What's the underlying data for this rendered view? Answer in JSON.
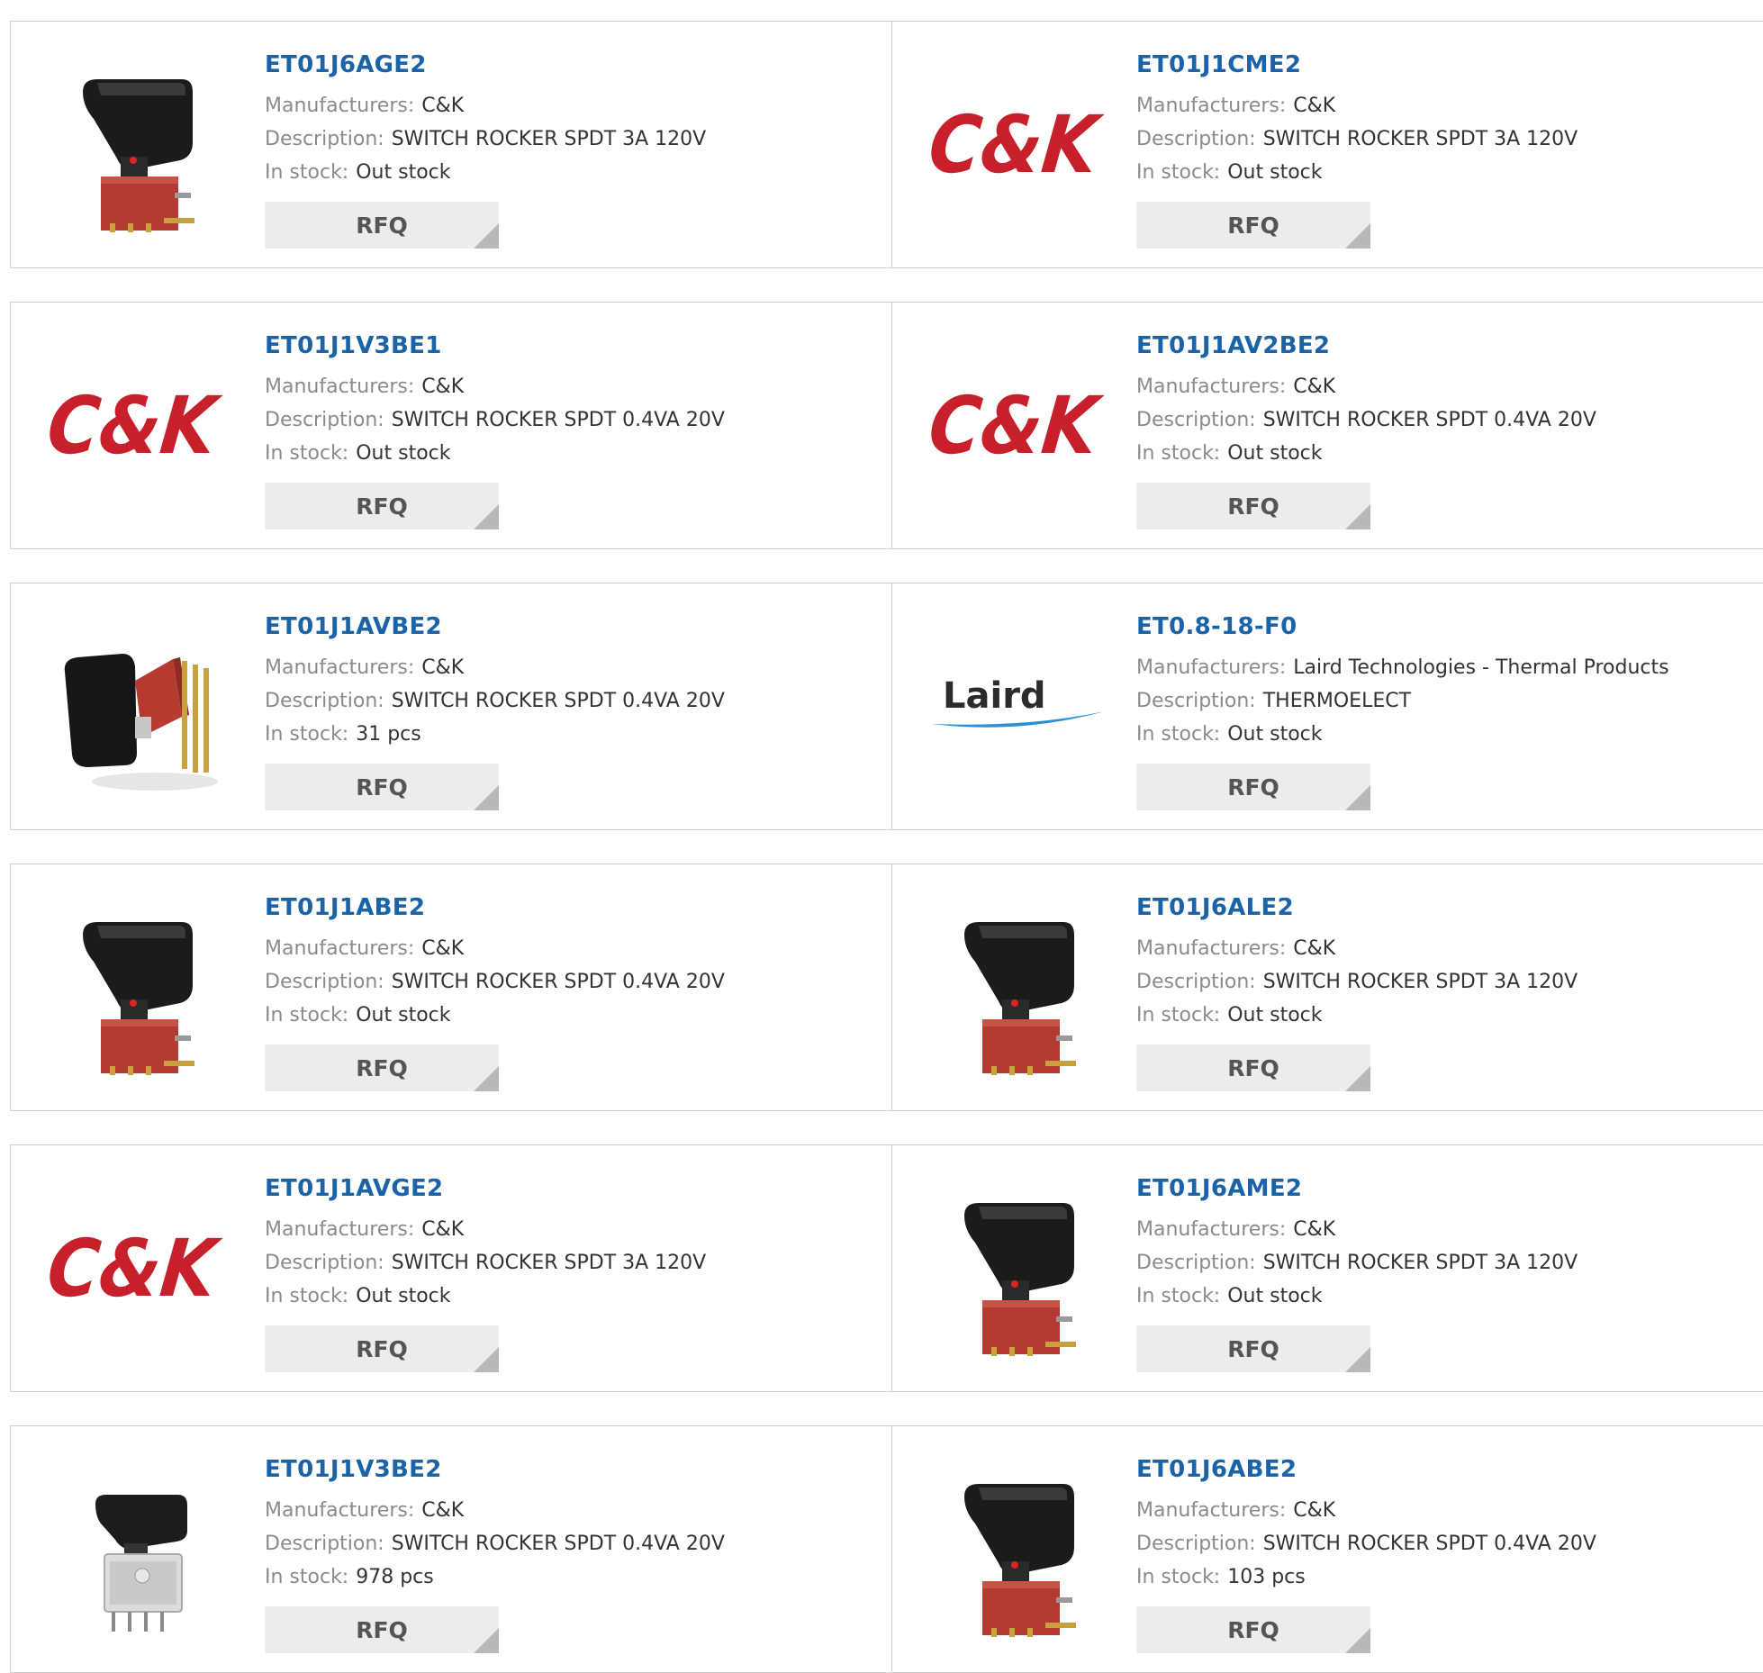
{
  "labels": {
    "manufacturers": "Manufacturers:",
    "description": "Description:",
    "in_stock": "In stock:",
    "rfq": "RFQ"
  },
  "products": [
    {
      "part": "ET01J6AGE2",
      "manufacturer": "C&K",
      "description": "SWITCH ROCKER SPDT 3A 120V",
      "stock": "Out stock",
      "image": "rocker-switch-red-base"
    },
    {
      "part": "ET01J1CME2",
      "manufacturer": "C&K",
      "description": "SWITCH ROCKER SPDT 3A 120V",
      "stock": "Out stock",
      "image": "ck-logo",
      "logo_text": "C&K"
    },
    {
      "part": "ET01J1V3BE1",
      "manufacturer": "C&K",
      "description": "SWITCH ROCKER SPDT 0.4VA 20V",
      "stock": "Out stock",
      "image": "ck-logo",
      "logo_text": "C&K"
    },
    {
      "part": "ET01J1AV2BE2",
      "manufacturer": "C&K",
      "description": "SWITCH ROCKER SPDT 0.4VA 20V",
      "stock": "Out stock",
      "image": "ck-logo",
      "logo_text": "C&K"
    },
    {
      "part": "ET01J1AVBE2",
      "manufacturer": "C&K",
      "description": "SWITCH ROCKER SPDT 0.4VA 20V",
      "stock": "31 pcs",
      "image": "rocker-switch-right-angle"
    },
    {
      "part": "ET0.8-18-F0",
      "manufacturer": "Laird Technologies - Thermal Products",
      "description": "THERMOELECT",
      "stock": "Out stock",
      "image": "laird-logo",
      "logo_text": "Laird"
    },
    {
      "part": "ET01J1ABE2",
      "manufacturer": "C&K",
      "description": "SWITCH ROCKER SPDT 0.4VA 20V",
      "stock": "Out stock",
      "image": "rocker-switch-red-base"
    },
    {
      "part": "ET01J6ALE2",
      "manufacturer": "C&K",
      "description": "SWITCH ROCKER SPDT 3A 120V",
      "stock": "Out stock",
      "image": "rocker-switch-red-base"
    },
    {
      "part": "ET01J1AVGE2",
      "manufacturer": "C&K",
      "description": "SWITCH ROCKER SPDT 3A 120V",
      "stock": "Out stock",
      "image": "ck-logo",
      "logo_text": "C&K"
    },
    {
      "part": "ET01J6AME2",
      "manufacturer": "C&K",
      "description": "SWITCH ROCKER SPDT 3A 120V",
      "stock": "Out stock",
      "image": "rocker-switch-red-base"
    },
    {
      "part": "ET01J1V3BE2",
      "manufacturer": "C&K",
      "description": "SWITCH ROCKER SPDT 0.4VA 20V",
      "stock": "978 pcs",
      "image": "rocker-switch-clear-base"
    },
    {
      "part": "ET01J6ABE2",
      "manufacturer": "C&K",
      "description": "SWITCH ROCKER SPDT 0.4VA 20V",
      "stock": "103 pcs",
      "image": "rocker-switch-red-base"
    }
  ],
  "colors": {
    "link": "#1a63a8",
    "ck_red": "#c8202a",
    "laird_blue": "#2a8fd6",
    "button_bg": "#ececec"
  }
}
